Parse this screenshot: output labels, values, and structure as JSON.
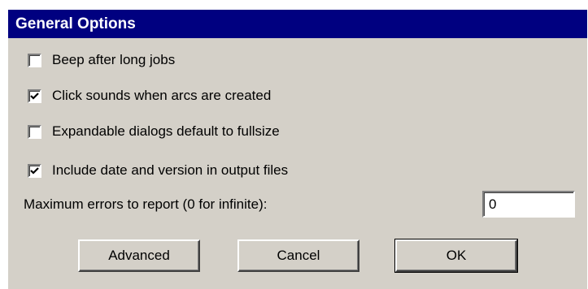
{
  "dialog": {
    "title": "General Options"
  },
  "options": [
    {
      "label": "Beep after long jobs",
      "checked": false
    },
    {
      "label": "Click sounds when arcs are created",
      "checked": true
    },
    {
      "label": "Expandable dialogs default to fullsize",
      "checked": false
    },
    {
      "label": "Include date and version in output files",
      "checked": true
    }
  ],
  "max_errors": {
    "label": "Maximum errors to report (0 for infinite):",
    "value": "0"
  },
  "buttons": {
    "advanced": "Advanced",
    "cancel": "Cancel",
    "ok": "OK"
  },
  "colors": {
    "titlebar": "#000080",
    "dialog_bg": "#d4d0c8"
  }
}
